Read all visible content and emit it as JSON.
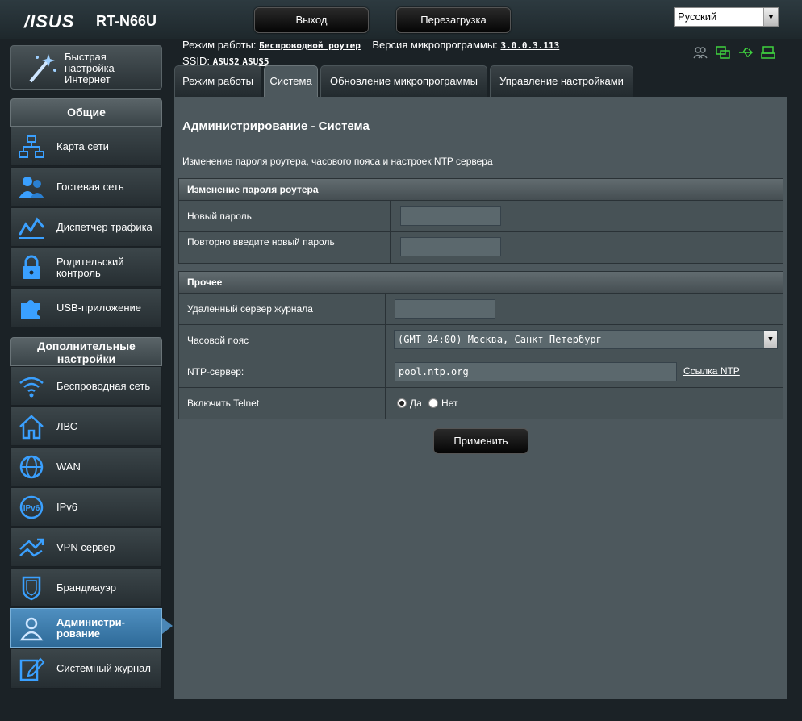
{
  "header": {
    "logo": "/ISUS",
    "model": "RT-N66U",
    "logout_label": "Выход",
    "reboot_label": "Перезагрузка",
    "language": "Русский"
  },
  "info": {
    "mode_label": "Режим работы:",
    "mode_value": "Беспроводной роутер",
    "firmware_label": "Версия микропрограммы:",
    "firmware_value": "3.0.0.3.113",
    "ssid_label": "SSID:",
    "ssid1": "ASUS2",
    "ssid2": "ASUS5"
  },
  "sidebar": {
    "qis_label": "Быстрая настройка Интернет",
    "general_header": "Общие",
    "general_items": [
      {
        "label": "Карта сети"
      },
      {
        "label": "Гостевая сеть"
      },
      {
        "label": "Диспетчер трафика"
      },
      {
        "label": "Родительский контроль"
      },
      {
        "label": "USB-приложение"
      }
    ],
    "advanced_header": "Дополнительные настройки",
    "advanced_items": [
      {
        "label": "Беспроводная сеть"
      },
      {
        "label": "ЛВС"
      },
      {
        "label": "WAN"
      },
      {
        "label": "IPv6"
      },
      {
        "label": "VPN сервер"
      },
      {
        "label": "Брандмауэр"
      },
      {
        "label": "Администри-рование"
      },
      {
        "label": "Системный журнал"
      }
    ]
  },
  "tabs": [
    {
      "label": "Режим работы"
    },
    {
      "label": "Система"
    },
    {
      "label": "Обновление микропрограммы"
    },
    {
      "label": "Управление настройками"
    }
  ],
  "panel": {
    "title": "Администрирование - Система",
    "description": "Изменение пароля роутера, часового пояса и настроек NTP сервера",
    "password_section": {
      "header": "Изменение пароля роутера",
      "new_password_label": "Новый пароль",
      "confirm_password_label": "Повторно введите новый пароль",
      "new_password_value": "",
      "confirm_password_value": ""
    },
    "misc_section": {
      "header": "Прочее",
      "log_server_label": "Удаленный сервер журнала",
      "log_server_value": "",
      "timezone_label": "Часовой пояс",
      "timezone_value": "(GMT+04:00) Москва, Санкт-Петербург",
      "ntp_label": "NTP-сервер:",
      "ntp_value": "pool.ntp.org",
      "ntp_link": "Ссылка NTP",
      "telnet_label": "Включить Telnet",
      "telnet_yes": "Да",
      "telnet_no": "Нет",
      "telnet_selected": "Да"
    },
    "apply_label": "Применить"
  }
}
